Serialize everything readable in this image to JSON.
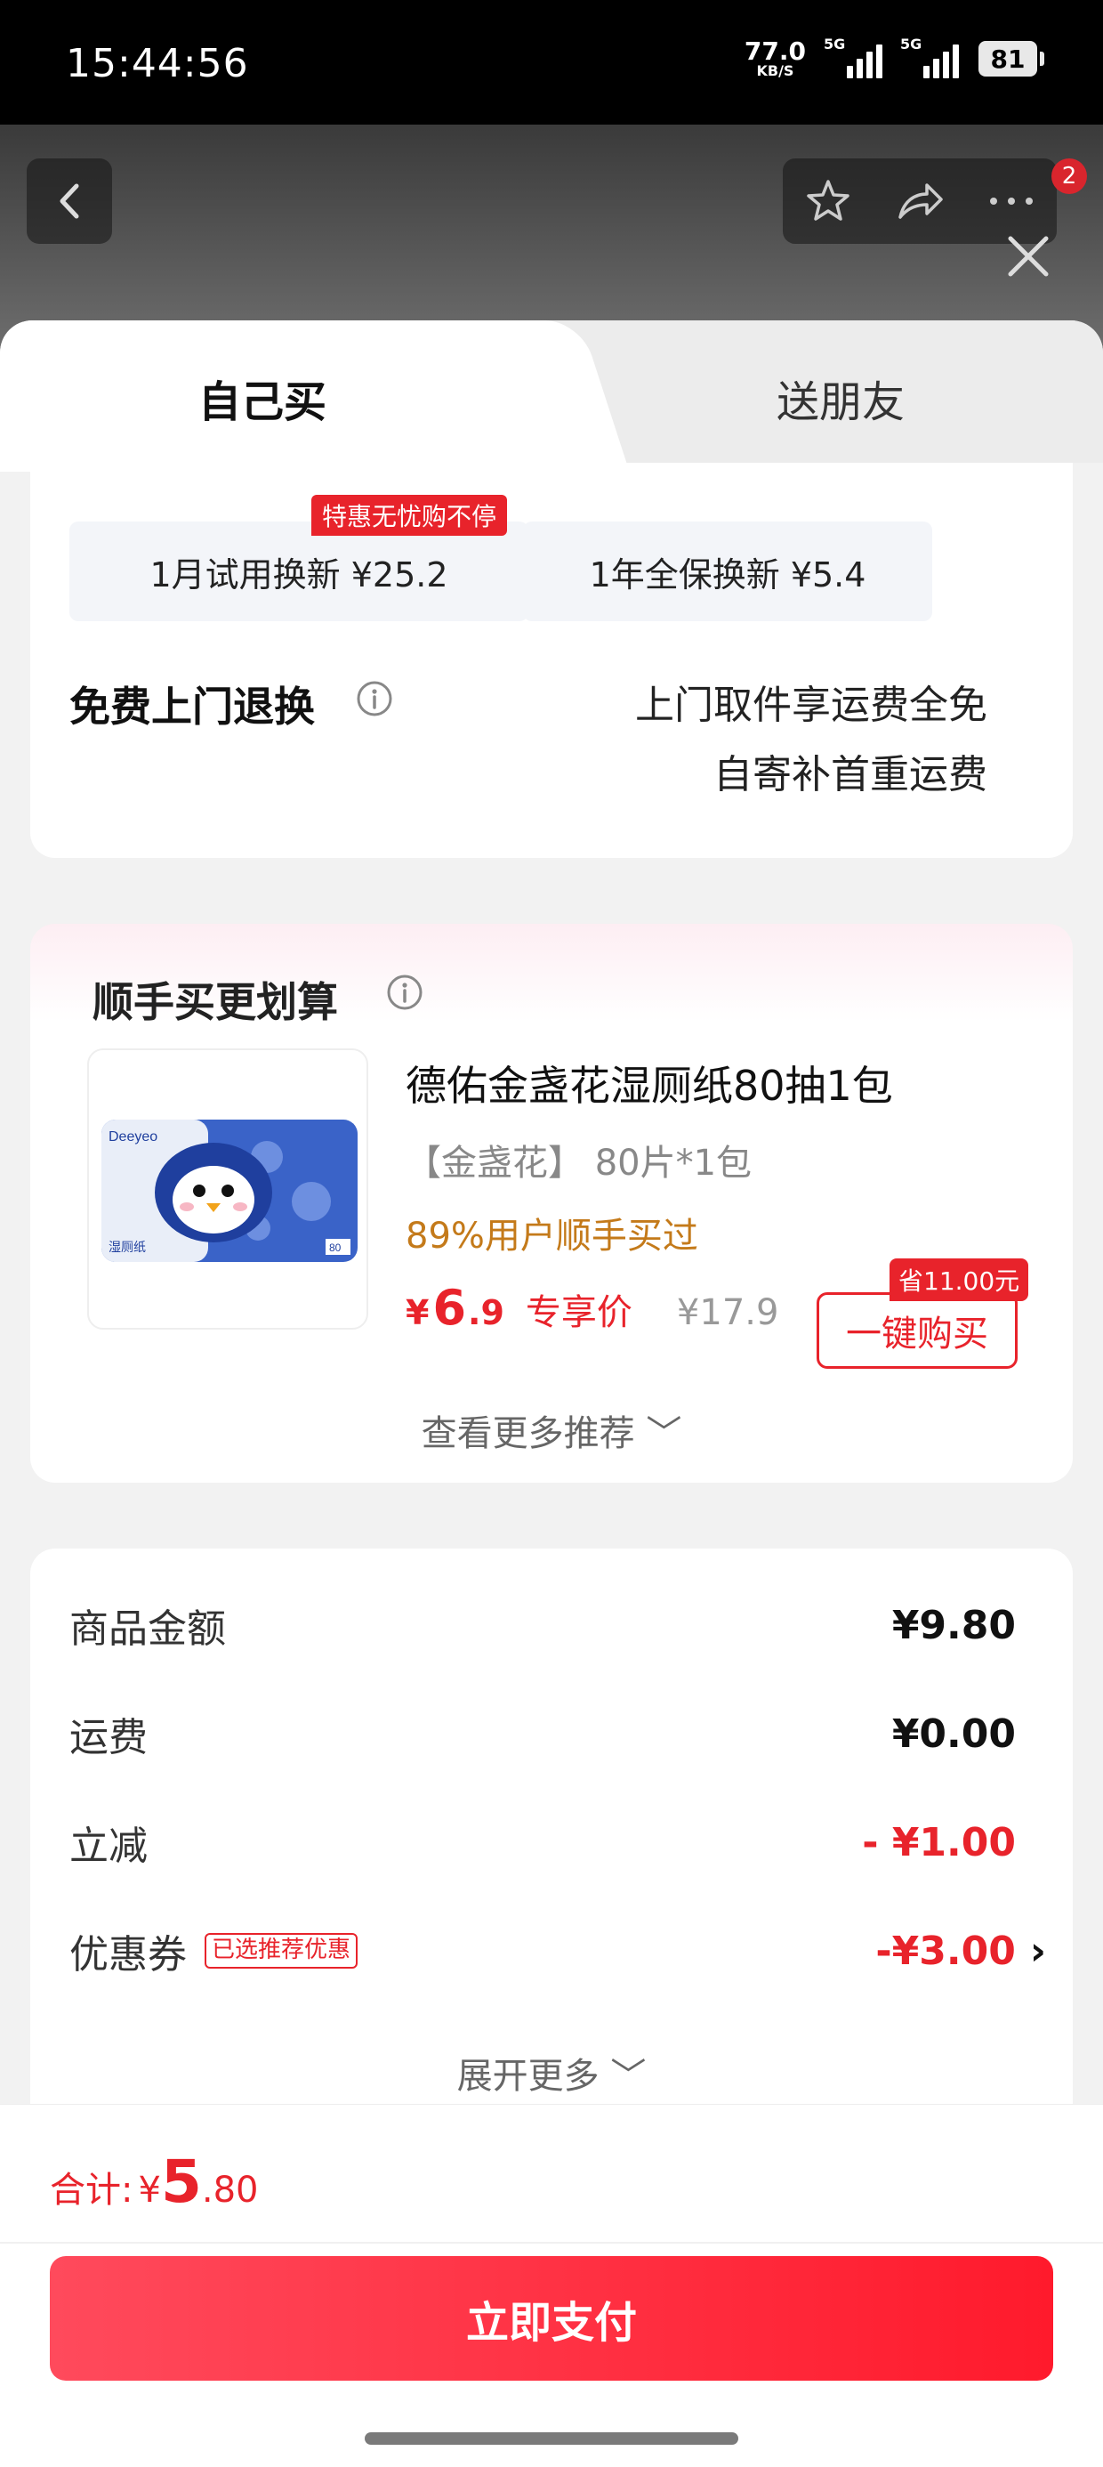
{
  "status_bar": {
    "time": "15:44:56",
    "net_speed": "77.0",
    "net_unit": "KB/S",
    "signal1_label": "5G",
    "signal2_label": "5G",
    "battery": "81"
  },
  "header": {
    "notification_count": "2"
  },
  "tabs": {
    "self_buy": "自己买",
    "gift_friend": "送朋友"
  },
  "protection": {
    "option1_tag": "特惠无忧购不停",
    "option1_label": "1月试用换新  ¥25.2",
    "option2_label": "1年全保换新  ¥5.4",
    "return_title": "免费上门退换",
    "return_line1": "上门取件享运费全免",
    "return_line2": "自寄补首重运费"
  },
  "bundle": {
    "title": "顺手买更划算",
    "product_name": "德佑金盏花湿厕纸80抽1包",
    "product_spec": "【金盏花】 80片*1包",
    "social_proof": "89%用户顺手买过",
    "price_symbol": "¥",
    "price_int": "6",
    "price_dec": ".9",
    "price_label": "专享价",
    "original_price": "¥17.9",
    "save_tag": "省11.00元",
    "buy_button": "一键购买",
    "more_label": "查看更多推荐 ﹀",
    "image_brand": "Deeyeo",
    "image_text": "湿厕纸",
    "image_count": "80"
  },
  "summary": {
    "rows": [
      {
        "label": "商品金额",
        "value": "¥9.80"
      },
      {
        "label": "运费",
        "value": "¥0.00"
      },
      {
        "label": "立减",
        "value": "- ¥1.00"
      },
      {
        "label": "优惠券",
        "tag": "已选推荐优惠",
        "value": "-¥3.00"
      }
    ],
    "expand_more": "展开更多 ﹀"
  },
  "footer": {
    "total_label": "合计:",
    "total_symbol": "¥",
    "total_int": "5",
    "total_dec": ".80",
    "pay_button": "立即支付"
  },
  "colors": {
    "accent_red": "#e8232b",
    "social_orange": "#c47a1a"
  }
}
